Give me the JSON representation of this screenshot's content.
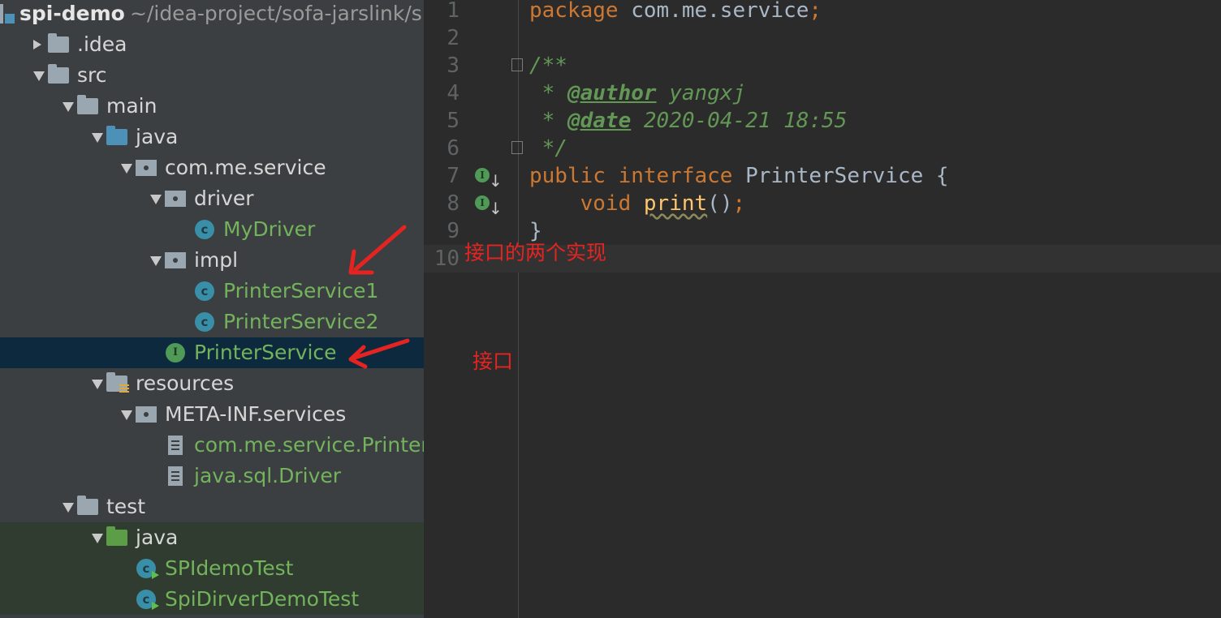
{
  "project": {
    "name": "spi-demo",
    "path": "~/idea-project/sofa-jarslink/sp"
  },
  "tree": [
    {
      "label": ".idea",
      "indent": 1,
      "toggle": "right",
      "icon": "folder-icon",
      "style": "normal"
    },
    {
      "label": "src",
      "indent": 1,
      "toggle": "down",
      "icon": "folder-icon",
      "style": "normal"
    },
    {
      "label": "main",
      "indent": 2,
      "toggle": "down",
      "icon": "folder-icon",
      "style": "normal"
    },
    {
      "label": "java",
      "indent": 3,
      "toggle": "down",
      "icon": "source-folder-icon",
      "style": "normal"
    },
    {
      "label": "com.me.service",
      "indent": 4,
      "toggle": "down",
      "icon": "package-icon",
      "style": "normal"
    },
    {
      "label": "driver",
      "indent": 5,
      "toggle": "down",
      "icon": "package-icon",
      "style": "normal"
    },
    {
      "label": "MyDriver",
      "indent": 6,
      "toggle": "none",
      "icon": "class-icon",
      "style": "green"
    },
    {
      "label": "impl",
      "indent": 5,
      "toggle": "down",
      "icon": "package-icon",
      "style": "normal"
    },
    {
      "label": "PrinterService1",
      "indent": 6,
      "toggle": "none",
      "icon": "class-icon",
      "style": "green"
    },
    {
      "label": "PrinterService2",
      "indent": 6,
      "toggle": "none",
      "icon": "class-icon",
      "style": "green"
    },
    {
      "label": "PrinterService",
      "indent": 5,
      "toggle": "none",
      "icon": "interface-icon",
      "style": "green",
      "selected": true
    },
    {
      "label": "resources",
      "indent": 3,
      "toggle": "down",
      "icon": "resources-folder-icon",
      "style": "normal"
    },
    {
      "label": "META-INF.services",
      "indent": 4,
      "toggle": "down",
      "icon": "package-icon",
      "style": "normal"
    },
    {
      "label": "com.me.service.PrinterService",
      "indent": 5,
      "toggle": "none",
      "icon": "file-icon",
      "style": "green"
    },
    {
      "label": "java.sql.Driver",
      "indent": 5,
      "toggle": "none",
      "icon": "file-icon",
      "style": "green"
    },
    {
      "label": "test",
      "indent": 2,
      "toggle": "down",
      "icon": "folder-icon",
      "style": "normal"
    },
    {
      "label": "java",
      "indent": 3,
      "toggle": "down",
      "icon": "test-folder-icon",
      "style": "normal",
      "test": true
    },
    {
      "label": "SPIdemoTest",
      "indent": 4,
      "toggle": "none",
      "icon": "test-class-icon",
      "style": "green",
      "test": true
    },
    {
      "label": "SpiDirverDemoTest",
      "indent": 4,
      "toggle": "none",
      "icon": "test-class-icon",
      "style": "green",
      "test": true
    }
  ],
  "editor": {
    "lines": [
      {
        "num": "1",
        "tokens": [
          {
            "t": "package",
            "c": "kw"
          },
          {
            "t": " com.me.service",
            "c": "plain"
          },
          {
            "t": ";",
            "c": "kw"
          }
        ]
      },
      {
        "num": "2",
        "tokens": []
      },
      {
        "num": "3",
        "tokens": [
          {
            "t": "/**",
            "c": "comment"
          }
        ],
        "fold": true
      },
      {
        "num": "4",
        "tokens": [
          {
            "t": " * ",
            "c": "comment"
          },
          {
            "t": "@author",
            "c": "tag"
          },
          {
            "t": " yangxj",
            "c": "comment"
          }
        ]
      },
      {
        "num": "5",
        "tokens": [
          {
            "t": " * ",
            "c": "comment"
          },
          {
            "t": "@date",
            "c": "tag"
          },
          {
            "t": " 2020-04-21 18:55",
            "c": "comment"
          }
        ]
      },
      {
        "num": "6",
        "tokens": [
          {
            "t": " */",
            "c": "comment"
          }
        ],
        "fold": true
      },
      {
        "num": "7",
        "tokens": [
          {
            "t": "public interface ",
            "c": "kw"
          },
          {
            "t": "PrinterService {",
            "c": "plain"
          }
        ],
        "impl_marker": true
      },
      {
        "num": "8",
        "tokens": [
          {
            "t": "    void ",
            "c": "kw"
          },
          {
            "t": "print",
            "c": "method"
          },
          {
            "t": "()",
            "c": "plain"
          },
          {
            "t": ";",
            "c": "kw"
          }
        ],
        "impl_marker": true
      },
      {
        "num": "9",
        "tokens": [
          {
            "t": "}",
            "c": "plain"
          }
        ]
      },
      {
        "num": "10",
        "tokens": [],
        "current": true
      }
    ]
  },
  "annotations": {
    "two_impls": "接口的两个实现",
    "interface": "接口"
  },
  "colors": {
    "annotation_red": "#e52421",
    "sidebar_bg": "#3c3f41",
    "editor_bg": "#2b2b2b",
    "selected_row": "#0d293e"
  }
}
